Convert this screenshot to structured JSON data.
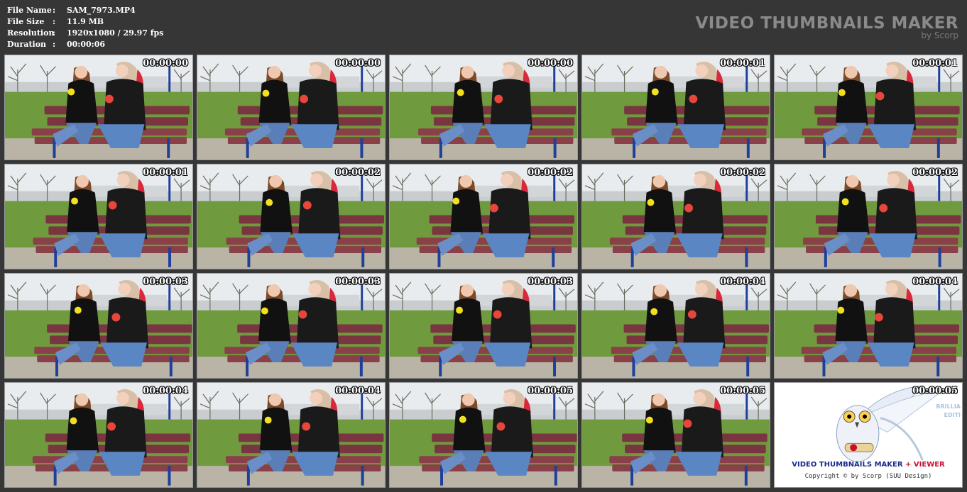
{
  "info": [
    {
      "label": "File Name",
      "value": "SAM_7973.MP4"
    },
    {
      "label": "File Size",
      "value": "11.9 MB"
    },
    {
      "label": "Resolution",
      "value": "1920x1080 / 29.97 fps"
    },
    {
      "label": "Duration",
      "value": "00:00:06"
    }
  ],
  "brand": {
    "title": "VIDEO THUMBNAILS MAKER",
    "subtitle": "by Scorp"
  },
  "thumbnails": [
    "00:00:00",
    "00:00:00",
    "00:00:00",
    "00:00:01",
    "00:00:01",
    "00:00:01",
    "00:00:02",
    "00:00:02",
    "00:00:02",
    "00:00:02",
    "00:00:03",
    "00:00:03",
    "00:00:03",
    "00:00:04",
    "00:00:04",
    "00:00:04",
    "00:00:04",
    "00:00:05",
    "00:00:05"
  ],
  "logo": {
    "timestamp": "00:00:05",
    "side_text_1": "BRILLIA",
    "side_text_2": "EDITI",
    "line1_a": "VIDEO THUMBNAILS MAKER",
    "line1_b": "+ VIEWER",
    "line2": "Copyright © by Scorp (SUU Design)"
  }
}
